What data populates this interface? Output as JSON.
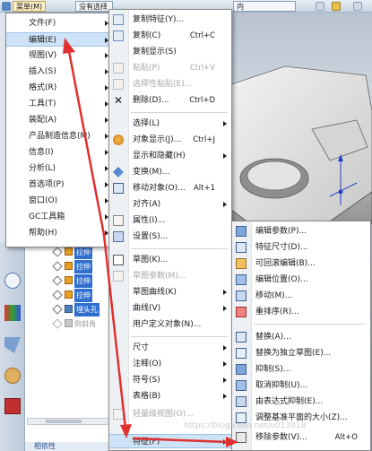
{
  "toolbar": {
    "menu_button": "菜单(M)",
    "selection_filter": "没有选择",
    "view_field": "内"
  },
  "colors": {
    "highlight": "#cfe3f6",
    "arrow": "#e03030",
    "selected_feature": "#2f6fd0"
  },
  "main_menu": {
    "items": [
      {
        "label": "文件(F)",
        "submenu": true
      },
      {
        "label": "编辑(E)",
        "submenu": true,
        "highlighted": true
      },
      {
        "label": "视图(V)",
        "submenu": true
      },
      {
        "label": "插入(S)",
        "submenu": true
      },
      {
        "label": "格式(R)",
        "submenu": true
      },
      {
        "label": "工具(T)",
        "submenu": true
      },
      {
        "label": "装配(A)",
        "submenu": true
      },
      {
        "label": "产品制造信息(M)",
        "submenu": true
      },
      {
        "label": "信息(I)",
        "submenu": true
      },
      {
        "label": "分析(L)",
        "submenu": true
      },
      {
        "label": "首选项(P)",
        "submenu": true
      },
      {
        "label": "窗口(O)",
        "submenu": true
      },
      {
        "label": "GC工具箱",
        "submenu": true
      },
      {
        "label": "帮助(H)",
        "submenu": true
      }
    ]
  },
  "edit_menu": {
    "items": [
      {
        "label": "复制特征(Y)...",
        "shortcut": "",
        "icon": "copy-feature-icon"
      },
      {
        "label": "复制(C)",
        "shortcut": "Ctrl+C",
        "icon": "copy-icon"
      },
      {
        "label": "复制显示(S)",
        "shortcut": "",
        "icon": "copy-display-icon"
      },
      {
        "label": "粘贴(P)",
        "shortcut": "Ctrl+V",
        "icon": "paste-icon",
        "disabled": true
      },
      {
        "label": "选择性粘贴(E)...",
        "shortcut": "",
        "icon": "paste-special-icon",
        "disabled": true
      },
      {
        "label": "删除(D)...",
        "shortcut": "Ctrl+D",
        "icon": "delete-icon"
      },
      {
        "label": "选择(L)",
        "shortcut": "",
        "icon": "select-icon",
        "submenu": true
      },
      {
        "label": "对象显示(J)...",
        "shortcut": "Ctrl+J",
        "icon": "object-display-icon"
      },
      {
        "label": "显示和隐藏(H)",
        "shortcut": "",
        "icon": "show-hide-icon",
        "submenu": true
      },
      {
        "label": "变换(M)...",
        "shortcut": "",
        "icon": "transform-icon"
      },
      {
        "label": "移动对象(O)...",
        "shortcut": "Alt+1",
        "icon": "move-object-icon"
      },
      {
        "label": "对齐(A)",
        "shortcut": "",
        "icon": "align-icon",
        "submenu": true
      },
      {
        "label": "属性(I)...",
        "shortcut": "",
        "icon": "properties-icon"
      },
      {
        "label": "设置(S)...",
        "shortcut": "",
        "icon": "settings-icon"
      },
      {
        "label": "草图(K)...",
        "shortcut": "",
        "icon": "sketch-icon"
      },
      {
        "label": "草图参数(M)...",
        "shortcut": "",
        "icon": "sketch-params-icon",
        "disabled": true
      },
      {
        "label": "草图曲线(K)",
        "shortcut": "",
        "icon": "sketch-curve-icon",
        "submenu": true
      },
      {
        "label": "曲线(V)",
        "shortcut": "",
        "icon": "curve-icon",
        "submenu": true
      },
      {
        "label": "用户定义对象(N)...",
        "shortcut": "",
        "icon": "user-object-icon"
      },
      {
        "label": "尺寸",
        "shortcut": "",
        "icon": "dimension-icon",
        "submenu": true
      },
      {
        "label": "注释(O)",
        "shortcut": "",
        "icon": "annotation-icon",
        "submenu": true
      },
      {
        "label": "符号(S)",
        "shortcut": "",
        "icon": "symbol-icon",
        "submenu": true
      },
      {
        "label": "表格(B)",
        "shortcut": "",
        "icon": "table-icon",
        "submenu": true
      },
      {
        "label": "轻量级视图(O)...",
        "shortcut": "",
        "icon": "lightweight-view-icon",
        "disabled": true
      },
      {
        "label": "特征(F)",
        "shortcut": "",
        "icon": "feature-icon",
        "submenu": true,
        "highlighted": true
      }
    ]
  },
  "feature_menu": {
    "items": [
      {
        "label": "编辑参数(P)...",
        "shortcut": "",
        "icon": "edit-params-icon"
      },
      {
        "label": "特征尺寸(D)...",
        "shortcut": "",
        "icon": "feature-dimension-icon"
      },
      {
        "label": "可回滚编辑(B)...",
        "shortcut": "",
        "icon": "rollback-edit-icon"
      },
      {
        "label": "编辑位置(O)...",
        "shortcut": "",
        "icon": "edit-position-icon"
      },
      {
        "label": "移动(M)...",
        "shortcut": "",
        "icon": "move-icon"
      },
      {
        "label": "重排序(R)...",
        "shortcut": "",
        "icon": "reorder-icon"
      },
      {
        "label": "替换(A)...",
        "shortcut": "",
        "icon": "replace-icon"
      },
      {
        "label": "替换为独立草图(E)...",
        "shortcut": "",
        "icon": "replace-sketch-icon"
      },
      {
        "label": "抑制(S)...",
        "shortcut": "",
        "icon": "suppress-icon"
      },
      {
        "label": "取消抑制(U)...",
        "shortcut": "",
        "icon": "unsuppress-icon"
      },
      {
        "label": "由表达式抑制(E)...",
        "shortcut": "",
        "icon": "expression-suppress-icon"
      },
      {
        "label": "调整基准平面的大小(Z)...",
        "shortcut": "",
        "icon": "resize-datum-icon"
      },
      {
        "label": "移除参数(V)...",
        "shortcut": "Alt+O",
        "icon": "remove-params-icon"
      }
    ]
  },
  "nav_tree": {
    "rows": [
      {
        "label": "拉伸",
        "selected": true
      },
      {
        "label": "拉伸",
        "selected": true
      },
      {
        "label": "拉伸",
        "selected": true
      },
      {
        "label": "拉伸",
        "selected": true
      },
      {
        "label": "埋头孔",
        "selected": true
      },
      {
        "label": "倒斜角",
        "selected": false
      }
    ],
    "bottom_tab": "相依性"
  },
  "watermark": "https://blog.csdn.net/u013018"
}
